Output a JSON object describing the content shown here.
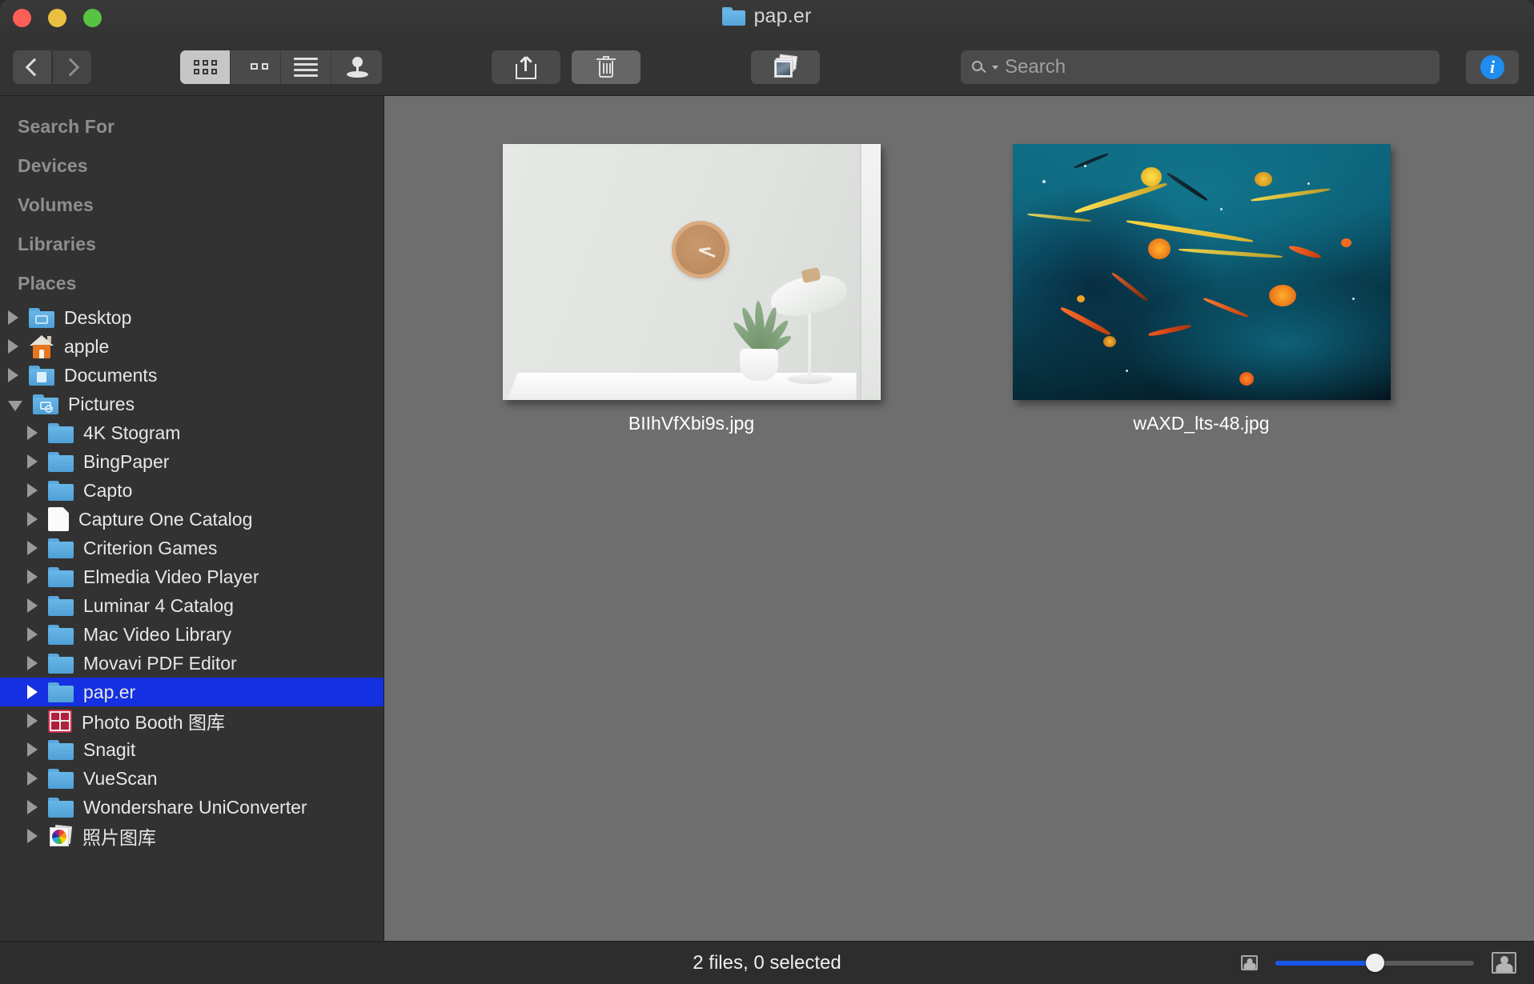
{
  "window": {
    "title": "pap.er",
    "title_icon": "folder-icon"
  },
  "traffic_lights": {
    "close": "close-button",
    "minimize": "minimize-button",
    "maximize": "maximize-button"
  },
  "toolbar": {
    "back": "back-button",
    "forward": "forward-button",
    "view_modes": [
      {
        "name": "icon-view",
        "icon": "grid-icon",
        "active": true
      },
      {
        "name": "column-view",
        "icon": "columns-icon",
        "active": false
      },
      {
        "name": "list-view",
        "icon": "list-icon",
        "active": false
      },
      {
        "name": "gallery-view",
        "icon": "pin-icon",
        "active": false
      }
    ],
    "share": "share-icon",
    "delete": "trash-icon",
    "slideshow": "photos-icon",
    "info": "info-icon",
    "info_glyph": "i"
  },
  "search": {
    "placeholder": "Search",
    "icon": "magnifier-icon",
    "value": ""
  },
  "sidebar": {
    "sections": [
      {
        "label": "Search For",
        "items": []
      },
      {
        "label": "Devices",
        "items": []
      },
      {
        "label": "Volumes",
        "items": []
      },
      {
        "label": "Libraries",
        "items": []
      },
      {
        "label": "Places",
        "items": [
          {
            "label": "Desktop",
            "icon": "folder-desktop-icon",
            "indent": 1,
            "expanded": false,
            "selected": false
          },
          {
            "label": "apple",
            "icon": "home-icon",
            "indent": 1,
            "expanded": false,
            "selected": false
          },
          {
            "label": "Documents",
            "icon": "folder-documents-icon",
            "indent": 1,
            "expanded": false,
            "selected": false
          },
          {
            "label": "Pictures",
            "icon": "folder-pictures-icon",
            "indent": 1,
            "expanded": true,
            "selected": false
          },
          {
            "label": "4K Stogram",
            "icon": "folder-icon",
            "indent": 2,
            "expanded": false,
            "selected": false
          },
          {
            "label": "BingPaper",
            "icon": "folder-icon",
            "indent": 2,
            "expanded": false,
            "selected": false
          },
          {
            "label": "Capto",
            "icon": "folder-icon",
            "indent": 2,
            "expanded": false,
            "selected": false
          },
          {
            "label": "Capture One Catalog",
            "icon": "document-icon",
            "indent": 2,
            "expanded": false,
            "selected": false
          },
          {
            "label": "Criterion Games",
            "icon": "folder-icon",
            "indent": 2,
            "expanded": false,
            "selected": false
          },
          {
            "label": "Elmedia Video Player",
            "icon": "folder-icon",
            "indent": 2,
            "expanded": false,
            "selected": false
          },
          {
            "label": "Luminar 4 Catalog",
            "icon": "folder-icon",
            "indent": 2,
            "expanded": false,
            "selected": false
          },
          {
            "label": "Mac Video Library",
            "icon": "folder-icon",
            "indent": 2,
            "expanded": false,
            "selected": false
          },
          {
            "label": "Movavi PDF Editor",
            "icon": "folder-icon",
            "indent": 2,
            "expanded": false,
            "selected": false
          },
          {
            "label": "pap.er",
            "icon": "folder-icon",
            "indent": 2,
            "expanded": false,
            "selected": true
          },
          {
            "label": "Photo Booth 图库",
            "icon": "photobooth-icon",
            "indent": 2,
            "expanded": false,
            "selected": false
          },
          {
            "label": "Snagit",
            "icon": "folder-icon",
            "indent": 2,
            "expanded": false,
            "selected": false
          },
          {
            "label": "VueScan",
            "icon": "folder-icon",
            "indent": 2,
            "expanded": false,
            "selected": false
          },
          {
            "label": "Wondershare UniConverter",
            "icon": "folder-icon",
            "indent": 2,
            "expanded": false,
            "selected": false
          },
          {
            "label": "照片图库",
            "icon": "photos-library-icon",
            "indent": 2,
            "expanded": false,
            "selected": false
          }
        ]
      }
    ]
  },
  "files": [
    {
      "name": "BIIhVfXbi9s.jpg",
      "thumbnail": "interior-clock-plant-lamp-photo"
    },
    {
      "name": "wAXD_lts-48.jpg",
      "thumbnail": "abstract-teal-paint-splatter-photo"
    }
  ],
  "status": {
    "text": "2 files, 0 selected",
    "zoom_small_icon": "small-thumbnail-icon",
    "zoom_large_icon": "large-thumbnail-icon",
    "zoom_percent": 50
  },
  "colors": {
    "selection_blue": "#1430e0",
    "slider_blue": "#1a56e8",
    "info_blue": "#1f8cf0",
    "sidebar_bg": "#323232",
    "content_bg": "#6e6e6e"
  }
}
